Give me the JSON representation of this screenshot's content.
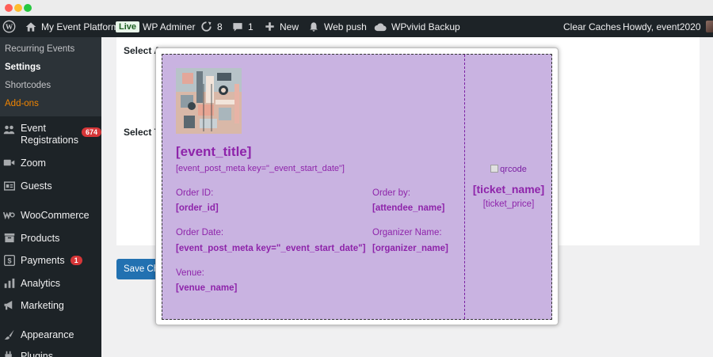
{
  "admin_bar": {
    "site_name": "My Event Platform",
    "live_badge": "Live",
    "user_switch": "WP Adminer",
    "updates_count": "8",
    "comments_count": "1",
    "new_label": "New",
    "web_push_label": "Web push",
    "backup_label": "WPvivid Backup",
    "clear_caches_label": "Clear Caches",
    "howdy_label": "Howdy, event2020"
  },
  "sidebar": {
    "submenu": [
      "Recurring Events",
      "Settings",
      "Shortcodes",
      "Add-ons"
    ],
    "items": [
      {
        "label": "Event Registrations",
        "icon": "groups-icon",
        "badge": "674"
      },
      {
        "label": "Zoom",
        "icon": "video-icon"
      },
      {
        "label": "Guests",
        "icon": "id-card-icon"
      },
      {
        "label": "WooCommerce",
        "icon": "woocommerce-icon"
      },
      {
        "label": "Products",
        "icon": "archive-icon"
      },
      {
        "label": "Payments",
        "icon": "payments-icon",
        "badge": "1"
      },
      {
        "label": "Analytics",
        "icon": "chart-icon"
      },
      {
        "label": "Marketing",
        "icon": "megaphone-icon"
      },
      {
        "label": "Appearance",
        "icon": "brush-icon"
      },
      {
        "label": "Plugins",
        "icon": "plug-icon"
      }
    ]
  },
  "settings": {
    "field1_label": "Select A",
    "field2_label": "Select T",
    "save_label": "Save Cha"
  },
  "ticket": {
    "event_title": "[event_title]",
    "event_date_meta": "[event_post_meta key=\"_event_start_date\"]",
    "order_id_label": "Order ID:",
    "order_id_value": "[order_id]",
    "order_by_label": "Order by:",
    "order_by_value": "[attendee_name]",
    "order_date_label": "Order Date:",
    "order_date_value": "[event_post_meta key=\"_event_start_date\"]",
    "organizer_label": "Organizer Name:",
    "organizer_value": "[organizer_name]",
    "venue_label": "Venue:",
    "venue_value": "[venue_name]",
    "qrcode_alt": "qrcode",
    "ticket_name": "[ticket_name]",
    "ticket_price": "[ticket_price]",
    "text_color": "#8e24aa",
    "background_color": "#c9b3e1"
  }
}
